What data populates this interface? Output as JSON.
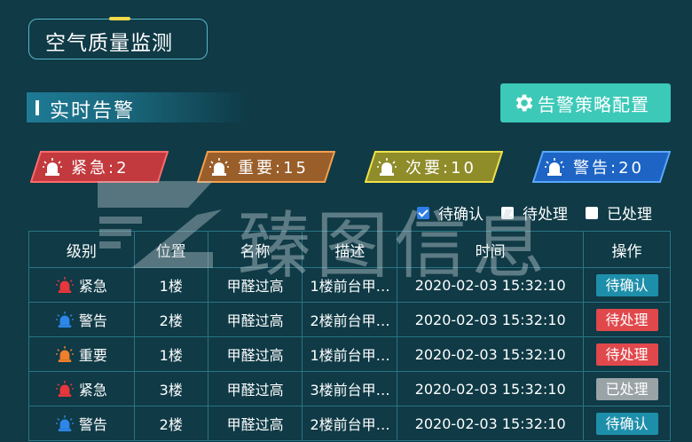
{
  "page_title": "空气质量监测",
  "section_title": "实时告警",
  "policy_button": {
    "label": "告警策略配置",
    "icon": "gear-icon"
  },
  "badges": [
    {
      "text": "紧急:2",
      "color": "#cc3b3f",
      "border": "#ff6a6a"
    },
    {
      "text": "重要:15",
      "color": "#a5642a",
      "border": "#f3a04e"
    },
    {
      "text": "次要:10",
      "color": "#9e9a2a",
      "border": "#f0e24a"
    },
    {
      "text": "警告:20",
      "color": "#1f6ccf",
      "border": "#59a8ff"
    }
  ],
  "filters": [
    {
      "label": "待确认",
      "checked": true
    },
    {
      "label": "待处理",
      "checked": false
    },
    {
      "label": "已处理",
      "checked": false
    }
  ],
  "table": {
    "headers": [
      "级别",
      "位置",
      "名称",
      "描述",
      "时间",
      "操作"
    ],
    "rows": [
      {
        "level": "紧急",
        "level_color": "#e8373b",
        "location": "1楼",
        "name": "甲醛过高",
        "desc": "1楼前台甲…",
        "time": "2020-02-03 15:32:10",
        "action": "待确认",
        "action_color": "#1e8faa"
      },
      {
        "level": "警告",
        "level_color": "#2d86e8",
        "location": "2楼",
        "name": "甲醛过高",
        "desc": "2楼前台甲…",
        "time": "2020-02-03 15:32:10",
        "action": "待处理",
        "action_color": "#e0484c"
      },
      {
        "level": "重要",
        "level_color": "#ef7f2a",
        "location": "1楼",
        "name": "甲醛过高",
        "desc": "1楼前台甲…",
        "time": "2020-02-03 15:32:10",
        "action": "待处理",
        "action_color": "#e0484c"
      },
      {
        "level": "紧急",
        "level_color": "#e8373b",
        "location": "3楼",
        "name": "甲醛过高",
        "desc": "3楼前台甲…",
        "time": "2020-02-03 15:32:10",
        "action": "已处理",
        "action_color": "#9aa3a6"
      },
      {
        "level": "警告",
        "level_color": "#2d86e8",
        "location": "2楼",
        "name": "甲醛过高",
        "desc": "2楼前台甲…",
        "time": "2020-02-03 15:32:10",
        "action": "待确认",
        "action_color": "#1e8faa"
      }
    ]
  },
  "watermark": "臻图信息"
}
